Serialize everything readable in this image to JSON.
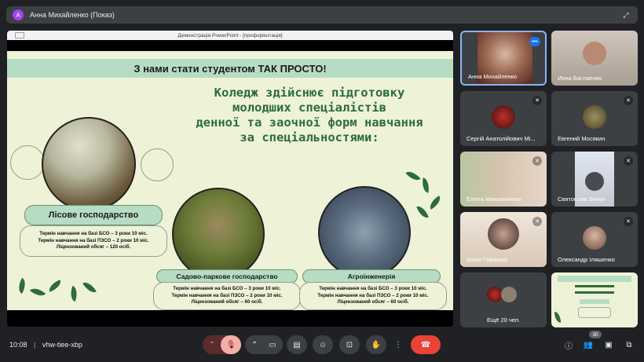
{
  "presenter": {
    "avatar_letter": "А",
    "name": "Анна Михайленко (Показ)"
  },
  "share": {
    "window_title": "Демонстрація PowerPoint - [профорієнтація]",
    "slide": {
      "header": "З нами стати студентом ТАК ПРОСТО!",
      "main_text": [
        "Коледж здійснює підготовку",
        "молодших спеціалістів",
        "денної та заочної форм навчання",
        "за спеціальностями:"
      ],
      "programs": [
        {
          "name": "Лісове господарство",
          "lines": [
            "Термін навчання на базі БСО – 3 роки 10 міс.",
            "Термін навчання на базі ПЗСО – 2 роки 10 міс.",
            "Ліцензований обсяг – 120 осіб."
          ]
        },
        {
          "name": "Садово-паркове господарство",
          "lines": [
            "Термін навчання на базі БСО – 3 роки 10 міс.",
            "Термін навчання на базі ПЗСО – 2 роки 10 міс.",
            "Ліцензований обсяг – 60 осіб."
          ]
        },
        {
          "name": "Агроінженерія",
          "lines": [
            "Термін навчання на базі БСО – 3 роки 10 міс.",
            "Термін навчання на базі ПЗСО – 2 роки 10 міс.",
            "Ліцензований обсяг – 60 осіб."
          ]
        }
      ]
    }
  },
  "participants": [
    {
      "name": "Анна Михайленко",
      "color": "#7a4a3a"
    },
    {
      "name": "Инна Баглаенко",
      "color": "#b88a72"
    },
    {
      "name": "Сергій Анатолійович Мі...",
      "color": "#5a1a14"
    },
    {
      "name": "Евгений Мосякин",
      "color": "#6b6040"
    },
    {
      "name": "Елена Михальченко",
      "color": "#c9a58c"
    },
    {
      "name": "Святослав Зінчук",
      "color": "#4a4a55"
    },
    {
      "name": "Ірина Говорука",
      "color": "#b58a76"
    },
    {
      "name": "Олександр Іляшенко",
      "color": "#8c7a6e"
    },
    {
      "name": "Ещё 20 чел."
    }
  ],
  "bottom": {
    "time": "10:08",
    "meeting_code": "vhw-tiee-xbp",
    "participant_count": "30"
  }
}
